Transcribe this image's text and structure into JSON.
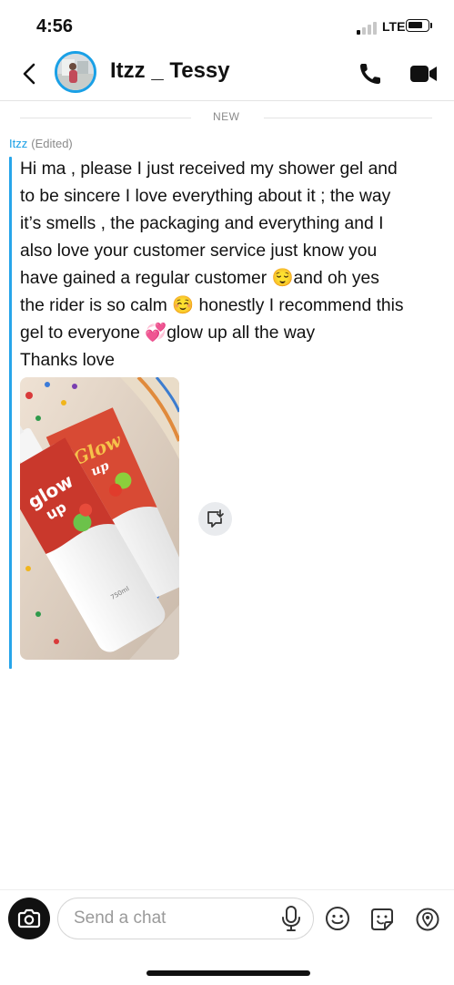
{
  "status_bar": {
    "time": "4:56",
    "network": "LTE",
    "signal_bars_active": 1,
    "signal_bars_total": 4,
    "battery_level": 0.65
  },
  "header": {
    "contact_name": "Itzz _ Tessy"
  },
  "divider": {
    "label": "NEW"
  },
  "message": {
    "sender": "Itzz",
    "edited_label": "(Edited)",
    "text": "Hi ma , please I just received my shower gel and\nto be sincere I love everything about it ; the way\nit’s smells , the packaging and everything and I\nalso love your customer service just know you\nhave gained a regular customer 😌and oh yes\nthe rider is so calm ☺️ honestly I recommend this\ngel to everyone 💞glow up all the way\nThanks love",
    "attachment": {
      "bottle_left_brand": "glow up",
      "bottle_right_brand": "Glow up",
      "volume_label": "750ml"
    }
  },
  "composer": {
    "placeholder": "Send a chat"
  },
  "icons": {
    "back": "chevron-left-icon",
    "call": "phone-icon",
    "video": "video-camera-icon",
    "save": "save-to-chat-icon",
    "camera": "camera-icon",
    "mic": "microphone-icon",
    "emoji": "smiley-icon",
    "sticker": "sticker-icon",
    "location": "location-pin-icon"
  },
  "colors": {
    "accent": "#1aa0e6",
    "text": "#111111",
    "muted": "#8a8a8a"
  }
}
